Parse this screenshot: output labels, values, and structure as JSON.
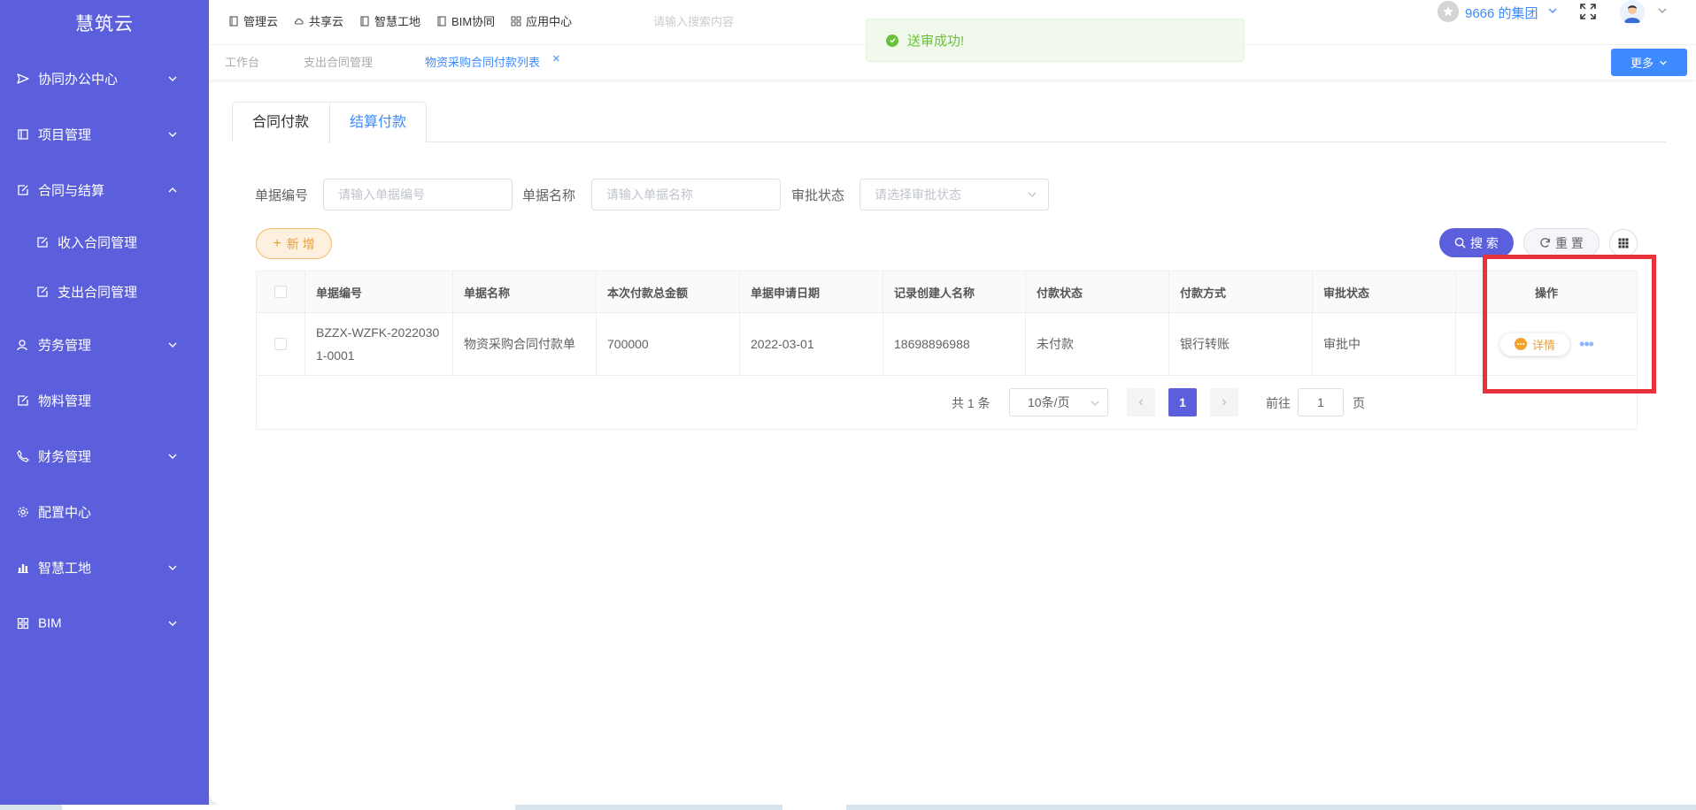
{
  "app": {
    "brand": "慧筑云"
  },
  "sidebar": {
    "items": [
      {
        "label": "协同办公中心",
        "icon": "send-icon",
        "expandable": true
      },
      {
        "label": "项目管理",
        "icon": "book-icon",
        "expandable": true
      },
      {
        "label": "合同与结算",
        "icon": "edit-doc-icon",
        "expandable": true,
        "expanded": true
      },
      {
        "label": "收入合同管理",
        "icon": "edit-doc-icon",
        "sub": true
      },
      {
        "label": "支出合同管理",
        "icon": "edit-doc-icon",
        "sub": true
      },
      {
        "label": "劳务管理",
        "icon": "users-icon",
        "expandable": true
      },
      {
        "label": "物料管理",
        "icon": "edit-doc-icon",
        "expandable": false
      },
      {
        "label": "财务管理",
        "icon": "phone-icon",
        "expandable": true
      },
      {
        "label": "配置中心",
        "icon": "gear-icon",
        "expandable": false
      },
      {
        "label": "智慧工地",
        "icon": "bar-chart-icon",
        "expandable": true
      },
      {
        "label": "BIM",
        "icon": "grid-icon",
        "expandable": true
      }
    ]
  },
  "top_nav": {
    "items": [
      {
        "label": "管理云",
        "icon": "doc-icon"
      },
      {
        "label": "共享云",
        "icon": "cloud-icon"
      },
      {
        "label": "智慧工地",
        "icon": "doc-icon"
      },
      {
        "label": "BIM协同",
        "icon": "doc-icon"
      },
      {
        "label": "应用中心",
        "icon": "grid-icon"
      }
    ],
    "search_ghost": "请输入搜索内容"
  },
  "user": {
    "org_name": "9666 的集团"
  },
  "tabs": {
    "items": [
      {
        "label": "工作台",
        "active": false
      },
      {
        "label": "支出合同管理",
        "active": false
      },
      {
        "label": "物资采购合同付款列表",
        "active": true
      }
    ],
    "close_glyph": "×",
    "more_label": "更多"
  },
  "toast": {
    "message": "送审成功!",
    "type": "success"
  },
  "content_tabs": [
    {
      "label": "合同付款",
      "active": false
    },
    {
      "label": "结算付款",
      "active": true
    }
  ],
  "filters": {
    "doc_no": {
      "label": "单据编号",
      "placeholder": "请输入单据编号"
    },
    "doc_name": {
      "label": "单据名称",
      "placeholder": "请输入单据名称"
    },
    "approval_status": {
      "label": "审批状态",
      "placeholder": "请选择审批状态"
    }
  },
  "actions": {
    "add": "新 增",
    "search": "搜 索",
    "reset": "重 置"
  },
  "table": {
    "columns": [
      "单据编号",
      "单据名称",
      "本次付款总金额",
      "单据申请日期",
      "记录创建人名称",
      "付款状态",
      "付款方式",
      "审批状态",
      "操作"
    ],
    "rows": [
      {
        "doc_no": "BZZX-WZFK-20220301-0001",
        "doc_name": "物资采购合同付款单",
        "amount": "700000",
        "date": "2022-03-01",
        "creator": "18698896988",
        "pay_status": "未付款",
        "pay_method": "银行转账",
        "approval_status": "审批中",
        "detail_label": "详情",
        "more_label": "•••"
      }
    ]
  },
  "pagination": {
    "total_text": "共 1 条",
    "page_size": "10条/页",
    "current_page": "1",
    "goto_label": "前往",
    "goto_value": "1",
    "unit": "页"
  },
  "colors": {
    "sidebar": "#5b5fdb",
    "accent": "#3d8bff",
    "highlight": "#e8313a",
    "success": "#67c23a",
    "warning": "#e6a23c"
  }
}
